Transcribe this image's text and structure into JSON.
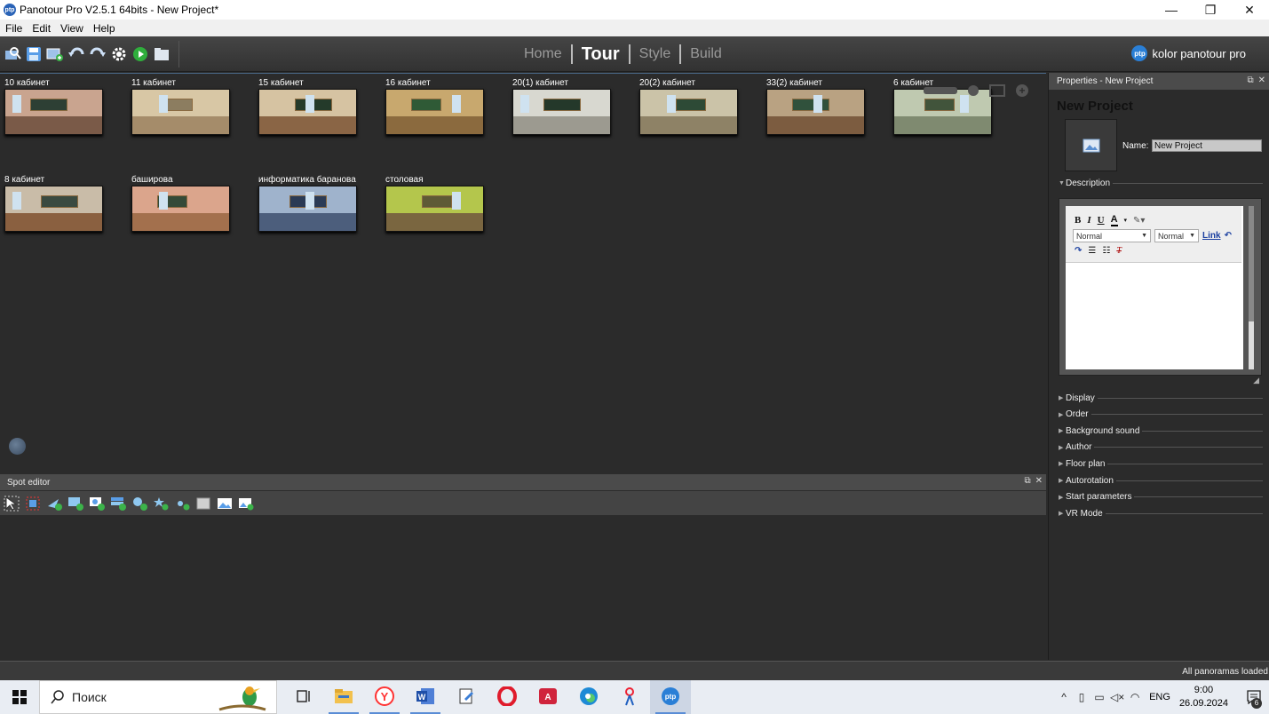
{
  "window": {
    "title": "Panotour Pro V2.5.1 64bits - New Project*",
    "minimize": "—",
    "maximize": "❐",
    "close": "✕"
  },
  "menu": [
    "File",
    "Edit",
    "View",
    "Help"
  ],
  "modes": {
    "items": [
      "Home",
      "Tour",
      "Style",
      "Build"
    ],
    "active": "Tour"
  },
  "brand": {
    "text": "kolor panotour pro",
    "logo": "ptp"
  },
  "panoramas": [
    {
      "label": "10 кабинет",
      "wall": "#c9a48f",
      "floor": "#7a5a48",
      "board": "#2d3f34"
    },
    {
      "label": "11 кабинет",
      "wall": "#d8c7a5",
      "floor": "#a58c6a",
      "board": "#8c7d60"
    },
    {
      "label": "15 кабинет",
      "wall": "#d6c3a2",
      "floor": "#8a6545",
      "board": "#243a2a"
    },
    {
      "label": "16 кабинет",
      "wall": "#c8a86e",
      "floor": "#8b6a3e",
      "board": "#2f5a36"
    },
    {
      "label": "20(1) кабинет",
      "wall": "#d8d8d0",
      "floor": "#9c9a90",
      "board": "#24382a"
    },
    {
      "label": "20(2) кабинет",
      "wall": "#cbc3a8",
      "floor": "#8e8266",
      "board": "#2d4a36"
    },
    {
      "label": "33(2) кабинет",
      "wall": "#b9a282",
      "floor": "#7c5c40",
      "board": "#30513c"
    },
    {
      "label": "6 кабинет",
      "wall": "#bfc9b0",
      "floor": "#7f8a70",
      "board": "#41543b"
    },
    {
      "label": "8 кабинет",
      "wall": "#c9bca8",
      "floor": "#8a6040",
      "board": "#3a4a40"
    },
    {
      "label": "баширова",
      "wall": "#dba58c",
      "floor": "#a3704d",
      "board": "#344a38"
    },
    {
      "label": "информатика баранова",
      "wall": "#9fb3cc",
      "floor": "#4c5e7c",
      "board": "#2b3b55"
    },
    {
      "label": "столовая",
      "wall": "#b4c64c",
      "floor": "#7a6640",
      "board": "#5e5a36"
    }
  ],
  "spot_editor": {
    "title": "Spot editor"
  },
  "properties": {
    "header": "Properties - New Project",
    "project_title": "New Project",
    "name_label": "Name:",
    "name_value": "New Project",
    "description_label": "Description",
    "editor": {
      "bold": "B",
      "italic": "I",
      "underline": "U",
      "font_color": "A",
      "format_select": "Normal",
      "size_select": "Normal",
      "link": "Link"
    },
    "sections": [
      "Display",
      "Order",
      "Background sound",
      "Author",
      "Floor plan",
      "Autorotation",
      "Start parameters",
      "VR Mode"
    ]
  },
  "status": {
    "text": "All panoramas loaded"
  },
  "taskbar": {
    "search_placeholder": "Поиск",
    "lang": "ENG",
    "time": "9:00",
    "date": "26.09.2024",
    "notifications": "6",
    "apps": [
      {
        "icon": "task-view-icon",
        "running": false
      },
      {
        "icon": "file-explorer-icon",
        "running": true
      },
      {
        "icon": "yandex-browser-icon",
        "running": true
      },
      {
        "icon": "word-icon",
        "running": true
      },
      {
        "icon": "notepad-icon",
        "running": false
      },
      {
        "icon": "opera-icon",
        "running": false
      },
      {
        "icon": "acrobat-icon",
        "running": false
      },
      {
        "icon": "edge-icon",
        "running": false
      },
      {
        "icon": "paint-icon",
        "running": false
      },
      {
        "icon": "panotour-icon",
        "running": true
      }
    ]
  },
  "colors": {
    "accent": "#4a6a8a",
    "panel_bg": "#2b2b2b",
    "header_bg": "#4b4b4b"
  }
}
